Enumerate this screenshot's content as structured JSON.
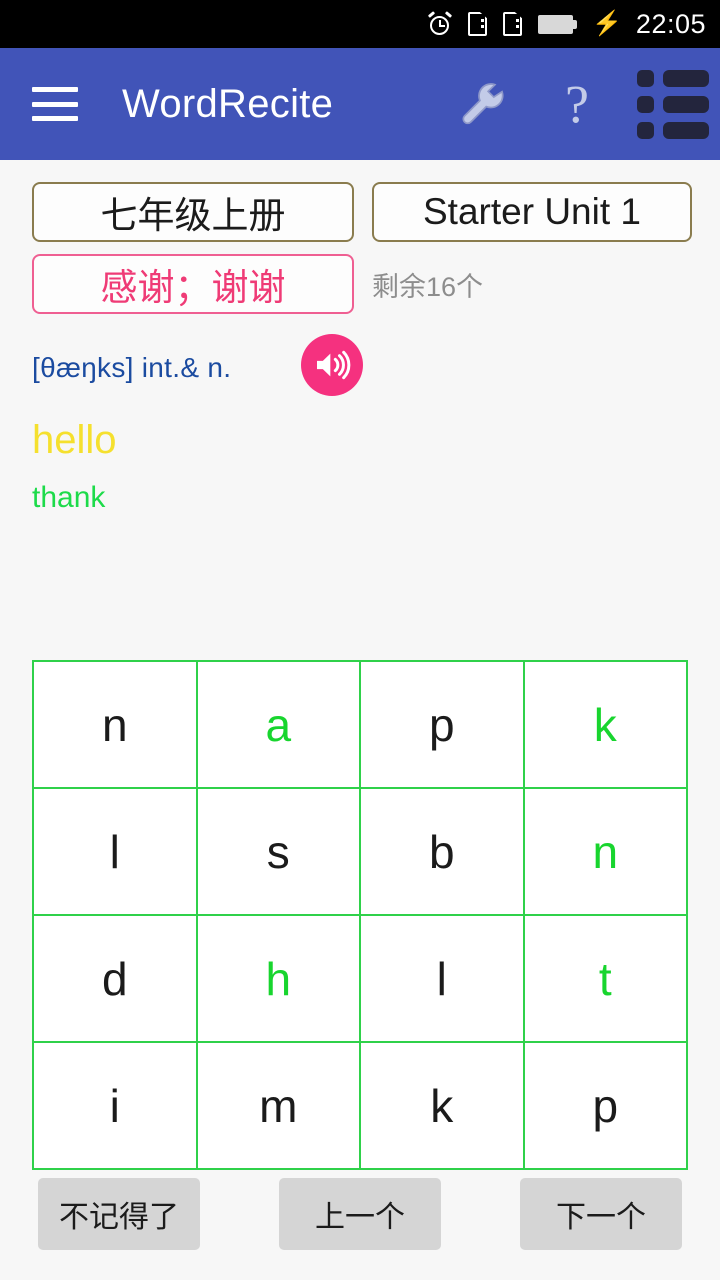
{
  "statusbar": {
    "time": "22:05",
    "icons": [
      "alarm-clock-icon",
      "sim1-icon",
      "sim2-icon",
      "battery-charging-icon"
    ]
  },
  "appbar": {
    "title": "WordRecite",
    "menu_icon": "hamburger-menu-icon",
    "actions": [
      {
        "name": "settings-wrench-icon",
        "glyph": "wrench"
      },
      {
        "name": "help-question-icon",
        "glyph": "?"
      },
      {
        "name": "word-list-icon",
        "glyph": "list"
      }
    ],
    "bg": "#4154b8"
  },
  "selectors": {
    "grade": "七年级上册",
    "unit": "Starter Unit 1",
    "border_color": "#8a7c4e"
  },
  "word": {
    "meaning": "感谢；谢谢",
    "meaning_color": "#ef3b76",
    "remaining": "剩余16个",
    "phonetic": "[θæŋks] int.& n.",
    "phonetic_color": "#1b4ba0",
    "hint": "hello",
    "hint_color": "#f5e02e",
    "answer": "thank",
    "answer_color": "#1ddb4a",
    "speaker_button": "play-audio-button"
  },
  "letter_grid": {
    "border_color": "#2fd14a",
    "used_color": "#18d52e",
    "rows": [
      [
        {
          "letter": "n",
          "used": false
        },
        {
          "letter": "a",
          "used": true
        },
        {
          "letter": "p",
          "used": false
        },
        {
          "letter": "k",
          "used": true
        }
      ],
      [
        {
          "letter": "l",
          "used": false
        },
        {
          "letter": "s",
          "used": false
        },
        {
          "letter": "b",
          "used": false
        },
        {
          "letter": "n",
          "used": true
        }
      ],
      [
        {
          "letter": "d",
          "used": false
        },
        {
          "letter": "h",
          "used": true
        },
        {
          "letter": "l",
          "used": false
        },
        {
          "letter": "t",
          "used": true
        }
      ],
      [
        {
          "letter": "i",
          "used": false
        },
        {
          "letter": "m",
          "used": false
        },
        {
          "letter": "k",
          "used": false
        },
        {
          "letter": "p",
          "used": false
        }
      ]
    ]
  },
  "bottom_buttons": [
    {
      "name": "forgot-button",
      "label": "不记得了"
    },
    {
      "name": "previous-button",
      "label": "上一个"
    },
    {
      "name": "next-button",
      "label": "下一个"
    }
  ]
}
